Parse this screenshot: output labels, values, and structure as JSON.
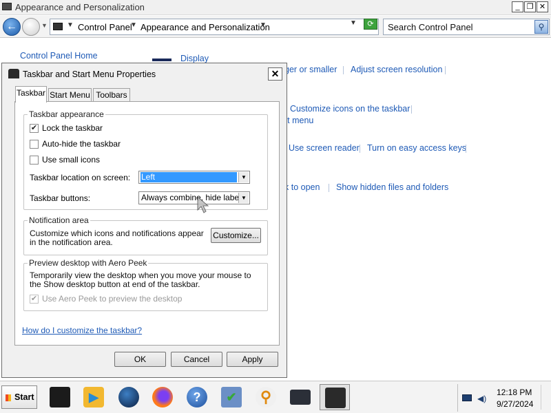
{
  "window": {
    "title": "Appearance and Personalization",
    "minimize": "_",
    "restore": "❐",
    "close": "✕"
  },
  "navbar": {
    "back": "←",
    "breadcrumb": [
      "Control Panel",
      "Appearance and Personalization"
    ],
    "refresh": "⟳",
    "search_placeholder": "Search Control Panel",
    "search_glyph": "⚲"
  },
  "control_panel": {
    "home_link": "Control Panel Home",
    "links": {
      "display": "Display",
      "bigger_smaller": "ger or smaller",
      "adjust_resolution": "Adjust screen resolution",
      "customize_icons": "Customize icons on the taskbar",
      "start_menu": "rt menu",
      "screen_reader": "Use screen reader",
      "easy_access": "Turn on easy access keys",
      "click_to_open": "k to open",
      "hidden_files": "Show hidden files and folders"
    }
  },
  "dialog": {
    "title": "Taskbar and Start Menu Properties",
    "close": "✕",
    "tabs": [
      "Taskbar",
      "Start Menu",
      "Toolbars"
    ],
    "active_tab": "Taskbar",
    "appearance": {
      "title": "Taskbar appearance",
      "options": [
        {
          "label": "Lock the taskbar",
          "checked": true
        },
        {
          "label": "Auto-hide the taskbar",
          "checked": false
        },
        {
          "label": "Use small icons",
          "checked": false
        }
      ],
      "location_label": "Taskbar location on screen:",
      "location_value": "Left",
      "buttons_label": "Taskbar buttons:",
      "buttons_value": "Always combine, hide labels"
    },
    "notification": {
      "title": "Notification area",
      "text": "Customize which icons and notifications appear in the notification area.",
      "customize_button": "Customize..."
    },
    "aero_peek": {
      "title": "Preview desktop with Aero Peek",
      "text": "Temporarily view the desktop when you move your mouse to the Show desktop button at end of the taskbar.",
      "option": {
        "label": "Use Aero Peek to preview the desktop",
        "checked": true,
        "disabled": true
      }
    },
    "help_link": "How do I customize the taskbar?",
    "buttons": {
      "ok": "OK",
      "cancel": "Cancel",
      "apply": "Apply"
    }
  },
  "taskbar": {
    "start_label": "Start",
    "pinned": [
      {
        "icon": "monitor-icon"
      },
      {
        "icon": "media-player-icon"
      },
      {
        "icon": "globe-icon"
      },
      {
        "icon": "firefox-icon"
      },
      {
        "icon": "help-icon"
      },
      {
        "icon": "tasks-icon"
      },
      {
        "icon": "magnifier-icon"
      },
      {
        "icon": "display-settings-icon"
      },
      {
        "icon": "control-panel-icon"
      }
    ],
    "clock": {
      "time": "12:18 PM",
      "date": "9/27/2024"
    }
  }
}
